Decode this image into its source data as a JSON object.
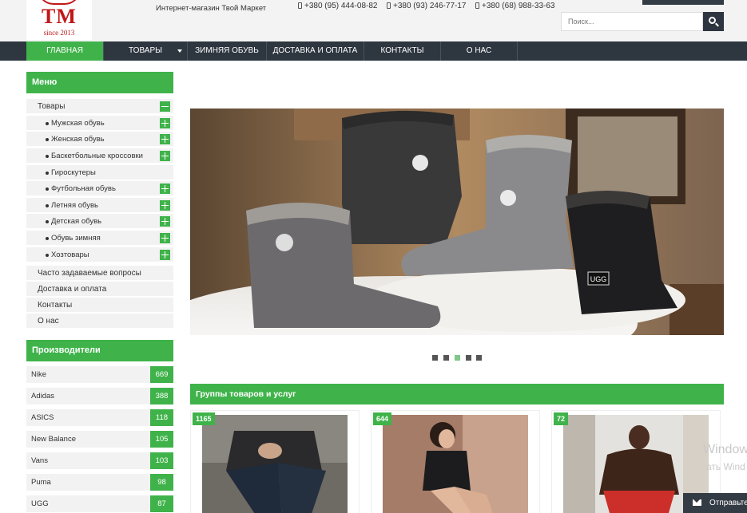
{
  "header": {
    "logo": {
      "text": "TM",
      "since": "since 2013"
    },
    "tagline": "Интернет-магазин Твой Маркет",
    "phones": [
      "+380 (95) 444-08-82",
      "+380 (93) 246-77-17",
      "+380 (68) 988-33-63"
    ],
    "search": {
      "placeholder": "Поиск..."
    }
  },
  "nav": {
    "items": [
      "ГЛАВНАЯ",
      "ТОВАРЫ",
      "ЗИМНЯЯ ОБУВЬ",
      "ДОСТАВКА И ОПЛАТА",
      "КОНТАКТЫ",
      "О НАС"
    ],
    "active": "ГЛАВНАЯ"
  },
  "sidebar": {
    "menu_title": "Меню",
    "menu": {
      "root": "Товары",
      "sub": [
        "Мужская обувь",
        "Женская обувь",
        "Баскетбольные кроссовки",
        "Гироскутеры",
        "Футбольная обувь",
        "Летняя обувь",
        "Детская обувь",
        "Обувь зимняя",
        "Хозтовары"
      ],
      "links": [
        "Часто задаваемые вопросы",
        "Доставка и оплата",
        "Контакты",
        "О нас"
      ]
    },
    "brands_title": "Производители",
    "brands": [
      {
        "name": "Nike",
        "count": "669"
      },
      {
        "name": "Adidas",
        "count": "388"
      },
      {
        "name": "ASICS",
        "count": "118"
      },
      {
        "name": "New Balance",
        "count": "105"
      },
      {
        "name": "Vans",
        "count": "103"
      },
      {
        "name": "Puma",
        "count": "98"
      },
      {
        "name": "UGG",
        "count": "87"
      }
    ]
  },
  "slider": {
    "slide_count": 5,
    "active_slide": 3,
    "boot_label": "UGG"
  },
  "groups": {
    "title": "Группы товаров и услуг",
    "cards": [
      {
        "count": "1165"
      },
      {
        "count": "644"
      },
      {
        "count": "72"
      }
    ]
  },
  "overlay": {
    "watermark1": "Window",
    "watermark2": "ать Wind",
    "send_label": "Отправьте"
  },
  "colors": {
    "accent": "#3fb34a",
    "nav_bg": "#2e3640",
    "logo_red": "#c01818"
  }
}
